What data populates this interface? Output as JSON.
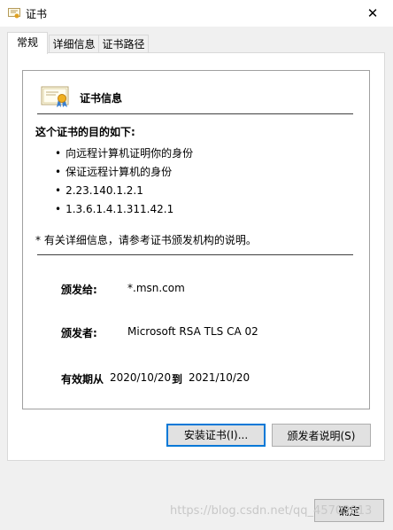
{
  "window": {
    "title": "证书",
    "close_glyph": "✕"
  },
  "tabs": [
    {
      "label": "常规",
      "active": true
    },
    {
      "label": "详细信息",
      "active": false
    },
    {
      "label": "证书路径",
      "active": false
    }
  ],
  "cert": {
    "info_title": "证书信息",
    "purpose_title": "这个证书的目的如下:",
    "purposes": [
      "向远程计算机证明你的身份",
      "保证远程计算机的身份",
      "2.23.140.1.2.1",
      "1.3.6.1.4.1.311.42.1"
    ],
    "note": "* 有关详细信息，请参考证书颁发机构的说明。",
    "issued_to_label": "颁发给:",
    "issued_to": "*.msn.com",
    "issued_by_label": "颁发者:",
    "issued_by": "Microsoft RSA TLS CA 02",
    "valid_from_label": "有效期从",
    "valid_from": "2020/10/20",
    "valid_to_label": "到",
    "valid_to": "2021/10/20"
  },
  "buttons": {
    "install": "安装证书(I)...",
    "issuer_statement": "颁发者说明(S)",
    "ok": "确定"
  },
  "watermark": "https://blog.csdn.net/qq_45703813"
}
